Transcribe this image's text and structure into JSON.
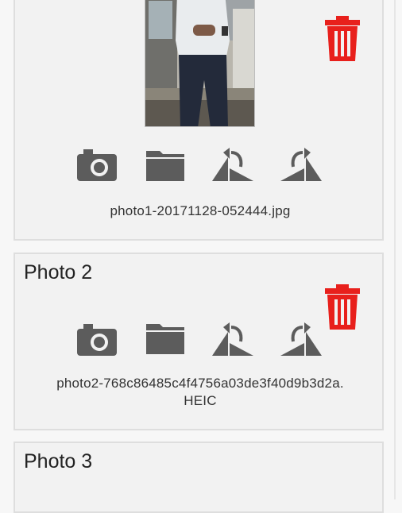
{
  "cards": [
    {
      "title": "",
      "filename": "photo1-20171128-052444.jpg"
    },
    {
      "title": "Photo 2",
      "filename_line1": "photo2-768c86485c4f4756a03de3f40d9b3d2a.",
      "filename_line2": "HEIC"
    },
    {
      "title": "Photo 3"
    }
  ],
  "icons": {
    "camera": "camera-icon",
    "folder": "folder-icon",
    "rotate_left": "rotate-left-icon",
    "rotate_right": "rotate-right-icon",
    "trash": "trash-icon"
  },
  "colors": {
    "icon_gray": "#5c5c5c",
    "trash_red": "#e8201c",
    "card_bg": "#f2f2f2",
    "card_border": "#dedede"
  }
}
